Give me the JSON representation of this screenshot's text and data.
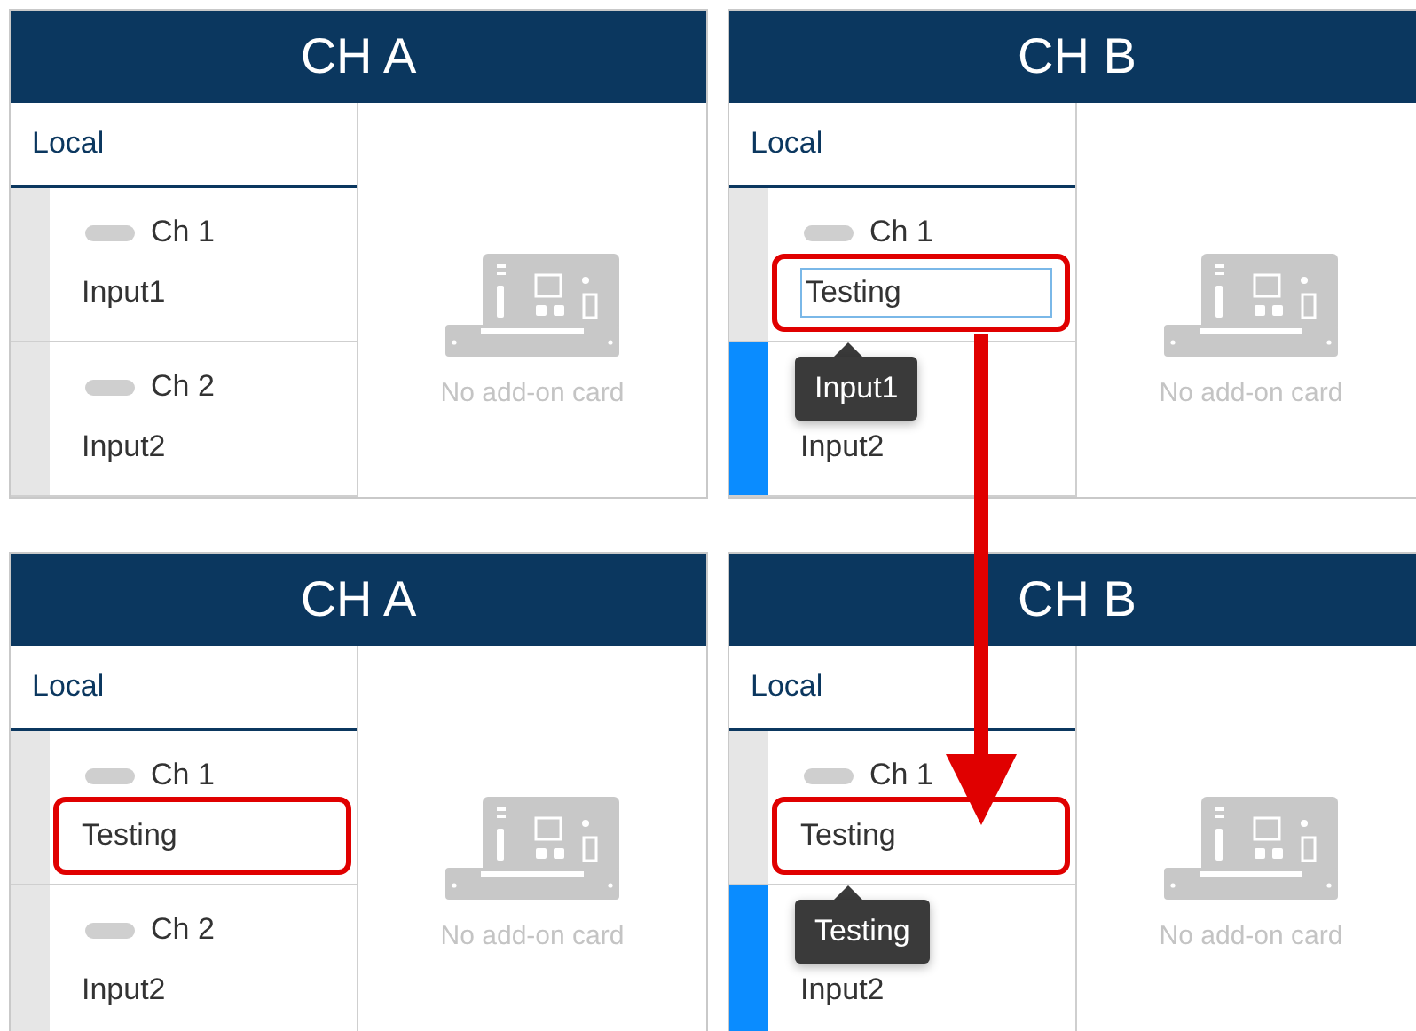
{
  "panels": [
    {
      "title": "CH A",
      "tab": "Local",
      "empty_message": "No add-on card",
      "channels": [
        {
          "label": "Ch 1",
          "kind": "text",
          "name": "Input1",
          "selected": false,
          "highlighted": false
        },
        {
          "label": "Ch 2",
          "kind": "text",
          "name": "Input2",
          "selected": false,
          "highlighted": false
        }
      ]
    },
    {
      "title": "CH B",
      "tab": "Local",
      "empty_message": "No add-on card",
      "channels": [
        {
          "label": "Ch 1",
          "kind": "field",
          "name": "Testing",
          "selected": false,
          "highlighted": true,
          "tooltip": "Input1"
        },
        {
          "kind": "text",
          "name": "Input2",
          "selected": true,
          "highlighted": false
        }
      ]
    },
    {
      "title": "CH A",
      "tab": "Local",
      "empty_message": "No add-on card",
      "channels": [
        {
          "label": "Ch 1",
          "kind": "text",
          "name": "Testing",
          "selected": false,
          "highlighted": true
        },
        {
          "label": "Ch 2",
          "kind": "text",
          "name": "Input2",
          "selected": false,
          "highlighted": false
        }
      ]
    },
    {
      "title": "CH B",
      "tab": "Local",
      "empty_message": "No add-on card",
      "channels": [
        {
          "label": "Ch 1",
          "kind": "text",
          "name": "Testing",
          "selected": false,
          "highlighted": true,
          "tooltip": "Testing"
        },
        {
          "kind": "text",
          "name": "Input2",
          "selected": true,
          "highlighted": false
        }
      ]
    }
  ]
}
